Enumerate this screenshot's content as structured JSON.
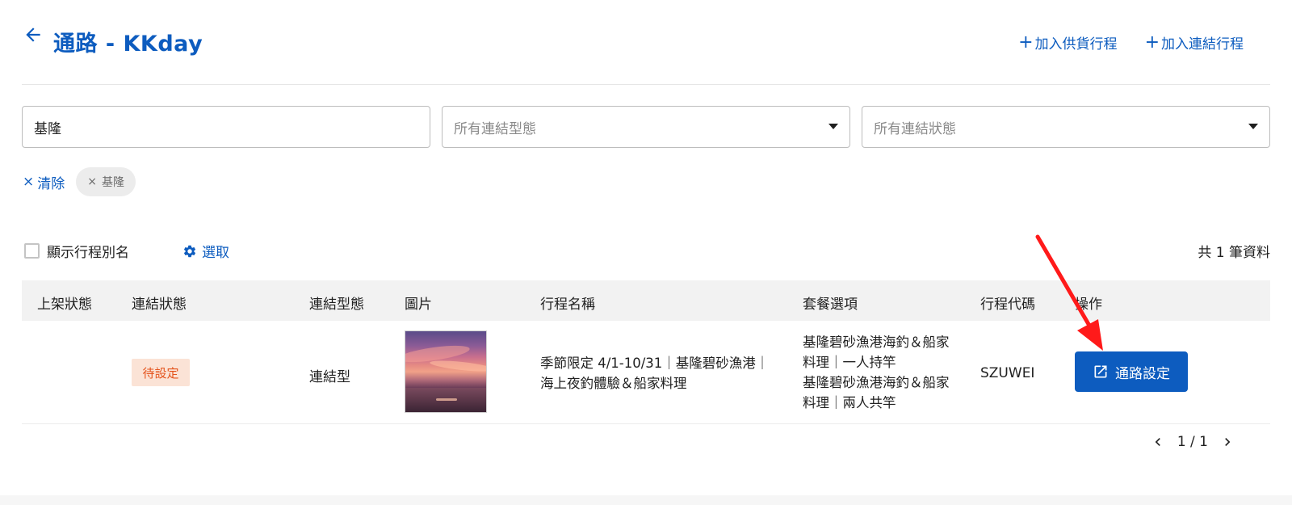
{
  "header": {
    "title": "通路  - KKday",
    "actions": [
      {
        "label": "加入供貨行程"
      },
      {
        "label": "加入連結行程"
      }
    ]
  },
  "filters": {
    "keyword": {
      "value": "基隆"
    },
    "link_type": {
      "placeholder": "所有連結型態"
    },
    "link_status": {
      "placeholder": "所有連結狀態"
    }
  },
  "chips": {
    "clear_label": "清除",
    "active": [
      {
        "label": "基隆"
      }
    ]
  },
  "toolbar": {
    "show_alias_label": "顯示行程別名",
    "select_label": "選取",
    "total": "共 1 筆資料"
  },
  "table": {
    "headers": [
      "上架狀態",
      "連結狀態",
      "連結型態",
      "圖片",
      "行程名稱",
      "套餐選項",
      "行程代碼",
      "操作"
    ],
    "rows": [
      {
        "listing_status": "",
        "link_status": "待設定",
        "link_type": "連結型",
        "image_alt": "sunset-sea-photo",
        "tour_name_line1": "季節限定 4/1-10/31｜基隆碧砂漁港｜",
        "tour_name_line2": "海上夜釣體驗＆船家料理",
        "package_1_line1": "基隆碧砂漁港海釣＆船家",
        "package_1_line2": "料理｜一人持竿",
        "package_2_line1": "基隆碧砂漁港海釣＆船家",
        "package_2_line2": "料理｜兩人共竿",
        "tour_code": "SZUWEI",
        "action_label": "通路設定"
      }
    ]
  },
  "pagination": {
    "text": "1 / 1"
  },
  "colors": {
    "primary": "#0d5cbf",
    "badge_bg": "#fbe3d6",
    "badge_text": "#e4531c",
    "annotation": "#ff1a1a"
  }
}
